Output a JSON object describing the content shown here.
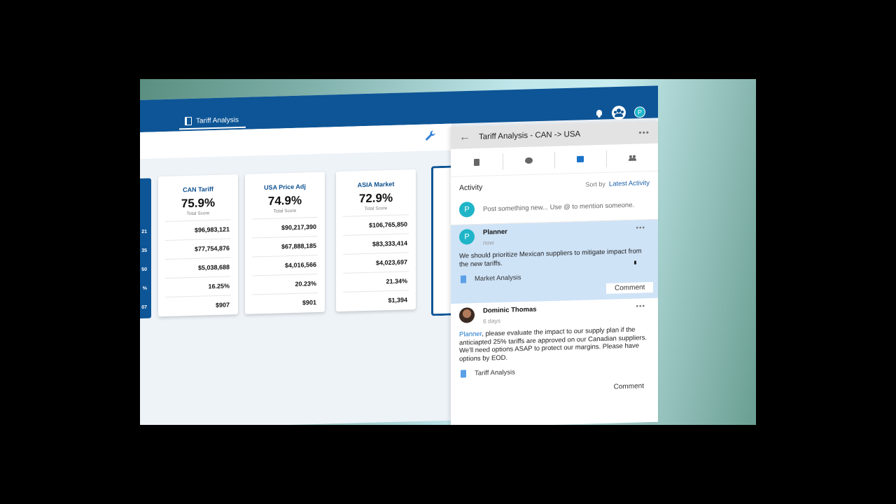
{
  "app": {
    "doc_tab": "Tariff Analysis",
    "avatar_initial": "P",
    "accent": "#0d5596"
  },
  "cards": [
    {
      "title": "CAN Tariff",
      "score": "75.9%",
      "sub": "Total Score",
      "rows": [
        "$96,983,121",
        "$77,754,876",
        "$5,038,688",
        "16.25%",
        "$907"
      ]
    },
    {
      "title": "USA Price Adj",
      "score": "74.9%",
      "sub": "Total Score",
      "rows": [
        "$90,217,390",
        "$67,888,185",
        "$4,016,566",
        "20.23%",
        "$901"
      ]
    },
    {
      "title": "ASIA Market",
      "score": "72.9%",
      "sub": "Total Score",
      "rows": [
        "$106,765,850",
        "$83,333,414",
        "$4,023,697",
        "21.34%",
        "$1,394"
      ]
    }
  ],
  "edge_card_values": [
    "21",
    "35",
    "50",
    "%",
    "07"
  ],
  "panel": {
    "title": "Tariff Analysis - CAN -> USA",
    "activity_label": "Activity",
    "sort_label": "Sort by",
    "sort_value": "Latest Activity",
    "post_placeholder": "Post something new... Use @ to mention someone.",
    "post_avatar": "P",
    "feed": [
      {
        "avatar": "P",
        "name": "Planner",
        "time": "now",
        "body": "We should prioritize Mexican suppliers to mitigate impact from the new tariffs.",
        "attachment": "Market Analysis",
        "comment": "Comment"
      },
      {
        "name": "Dominic Thomas",
        "time": "6 days",
        "mention": "Planner",
        "body": ", please evaluate the impact to our supply plan if the anticiapted 25% tariffs are approved on our Canadian suppliers. We'll need options ASAP to protect our margins. Please have options by EOD.",
        "attachment": "Tariff Analysis",
        "comment": "Comment"
      }
    ]
  }
}
